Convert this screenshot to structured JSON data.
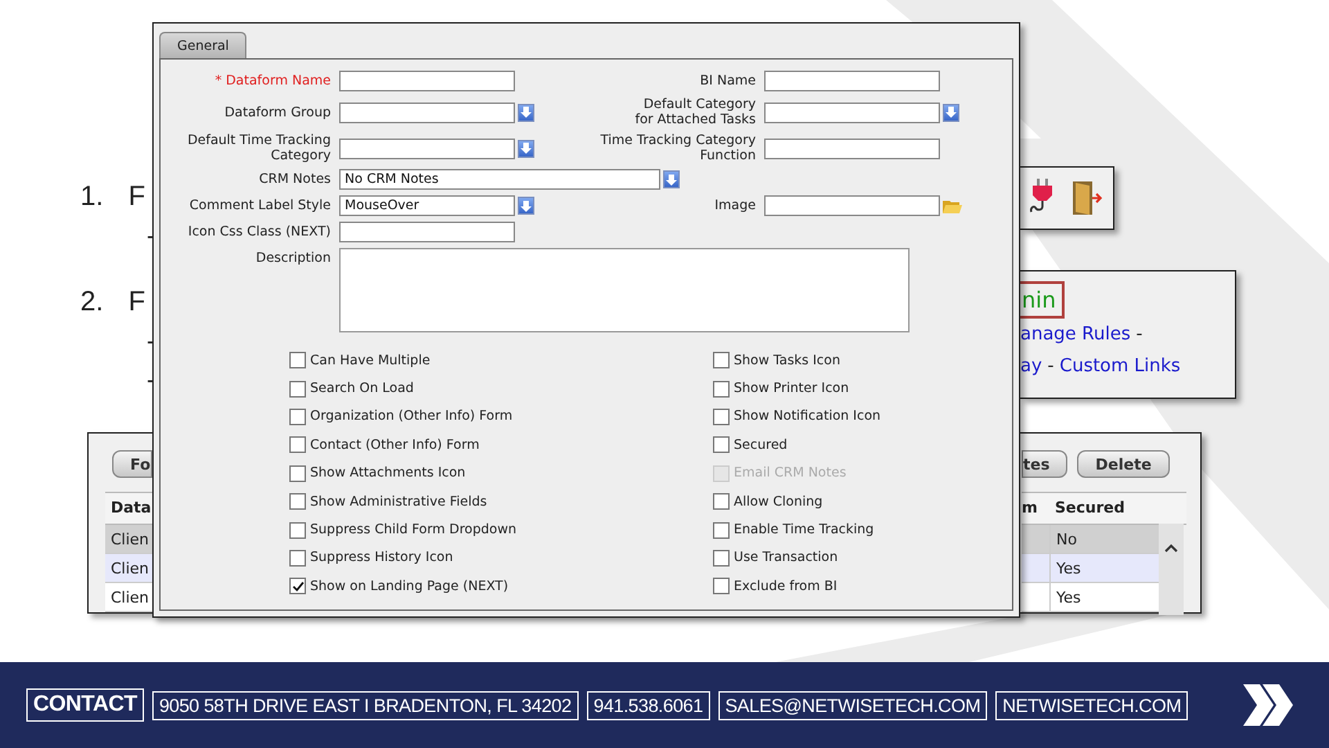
{
  "slide_list": [
    {
      "number": "1.",
      "text": "F",
      "bullets": [
        "-"
      ]
    },
    {
      "number": "2.",
      "text": "F",
      "bullets": [
        "-",
        "-"
      ]
    }
  ],
  "toolbar": {
    "kind": "icons"
  },
  "links_panel": {
    "heading": "nin",
    "lines": [
      [
        {
          "text": "anage Rules",
          "kind": "link"
        },
        {
          "text": "-",
          "kind": "separator"
        }
      ],
      [
        {
          "text": "ay",
          "kind": "link"
        },
        {
          "text": "-",
          "kind": "separator"
        },
        {
          "text": "Custom Links",
          "kind": "link"
        }
      ]
    ]
  },
  "grid": {
    "left_buttons": [
      "Fo"
    ],
    "right_buttons": [
      "tes",
      "Delete"
    ],
    "left_columns": [
      "Data"
    ],
    "right_columns": [
      "m",
      "Secured"
    ],
    "rows": [
      {
        "column_1": "Clien",
        "secured": "No",
        "selected": true,
        "hover": false
      },
      {
        "column_1": "Clien",
        "secured": "Yes",
        "selected": false,
        "hover": true
      },
      {
        "column_1": "Clien",
        "secured": "Yes",
        "selected": false,
        "hover": false
      }
    ]
  },
  "dialog": {
    "tabs": [
      {
        "label": "General",
        "selected": true
      }
    ],
    "fields": [
      {
        "label": "* Dataform Name",
        "required": true,
        "kind": "text"
      },
      {
        "label": "BI Name",
        "required": false,
        "kind": "text"
      },
      {
        "label": "Dataform Group",
        "required": false,
        "kind": "select"
      },
      {
        "label": "Default Category\nfor Attached Tasks",
        "required": false,
        "kind": "select"
      },
      {
        "label": "Default Time Tracking\nCategory",
        "required": false,
        "kind": "select"
      },
      {
        "label": "Time Tracking Category\nFunction",
        "required": false,
        "kind": "text"
      },
      {
        "label": "CRM Notes",
        "required": false,
        "kind": "wide-select",
        "value": "No CRM Notes"
      },
      {
        "label": "Comment Label Style",
        "required": false,
        "kind": "select",
        "value": "MouseOver"
      },
      {
        "label": "Image",
        "required": false,
        "kind": "file"
      },
      {
        "label": "Icon Css Class (NEXT)",
        "required": false,
        "kind": "text"
      },
      {
        "label": "Description",
        "required": false,
        "kind": "textarea"
      }
    ],
    "checkboxes_left": [
      {
        "label": "Can Have Multiple",
        "checked": false,
        "disabled": false
      },
      {
        "label": "Search On Load",
        "checked": false,
        "disabled": false
      },
      {
        "label": "Organization (Other Info) Form",
        "checked": false,
        "disabled": false
      },
      {
        "label": "Contact (Other Info) Form",
        "checked": false,
        "disabled": false
      },
      {
        "label": "Show Attachments Icon",
        "checked": false,
        "disabled": false
      },
      {
        "label": "Show Administrative Fields",
        "checked": false,
        "disabled": false
      },
      {
        "label": "Suppress Child Form Dropdown",
        "checked": false,
        "disabled": false
      },
      {
        "label": "Suppress History Icon",
        "checked": false,
        "disabled": false
      },
      {
        "label": "Show on Landing Page (NEXT)",
        "checked": true,
        "disabled": false
      }
    ],
    "checkboxes_right": [
      {
        "label": "Show Tasks Icon",
        "checked": false,
        "disabled": false
      },
      {
        "label": "Show Printer Icon",
        "checked": false,
        "disabled": false
      },
      {
        "label": "Show Notification Icon",
        "checked": false,
        "disabled": false
      },
      {
        "label": "Secured",
        "checked": false,
        "disabled": false
      },
      {
        "label": "Email CRM Notes",
        "checked": false,
        "disabled": true
      },
      {
        "label": "Allow Cloning",
        "checked": false,
        "disabled": false
      },
      {
        "label": "Enable Time Tracking",
        "checked": false,
        "disabled": false
      },
      {
        "label": "Use Transaction",
        "checked": false,
        "disabled": false
      },
      {
        "label": "Exclude from BI",
        "checked": false,
        "disabled": false
      }
    ]
  },
  "footer": {
    "heading": "CONTACT",
    "items": [
      "9050 58TH DRIVE EAST I BRADENTON, FL 34202",
      "941.538.6061",
      "SALES@NETWISETECH.COM",
      "NETWISETECH.COM"
    ]
  }
}
